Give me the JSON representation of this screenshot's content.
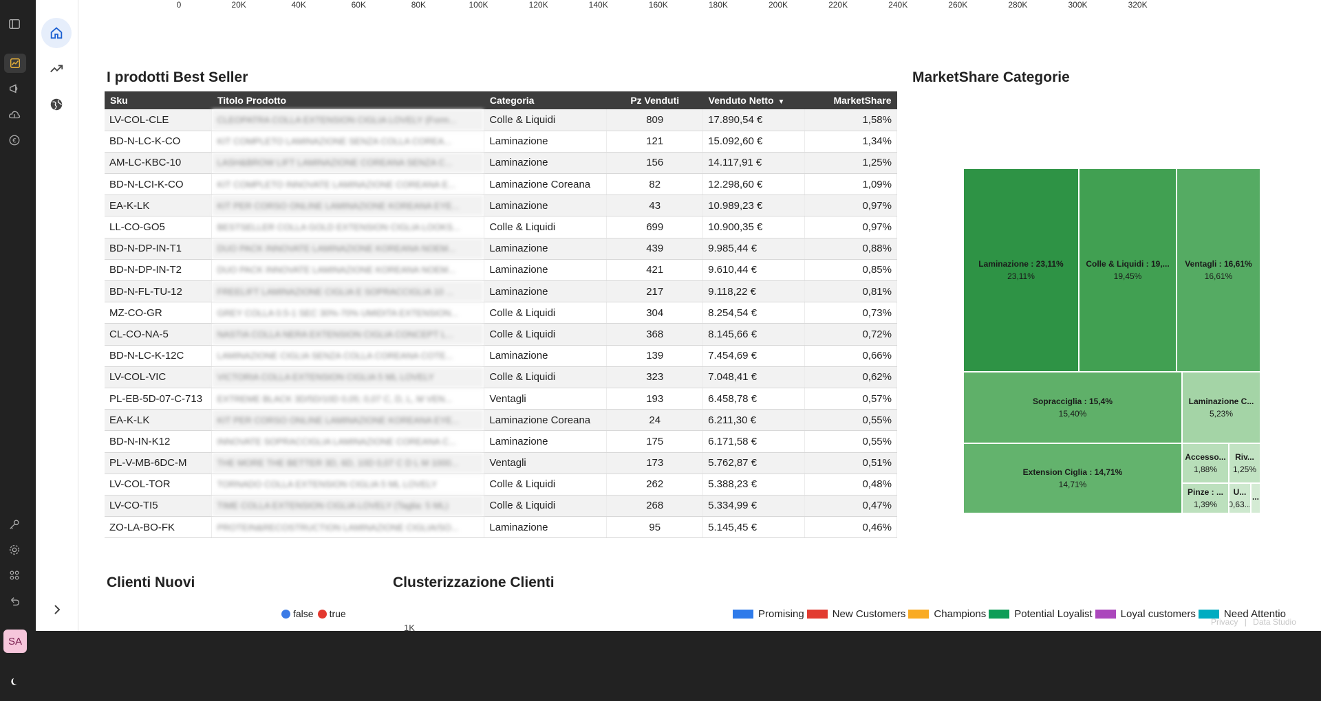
{
  "rail": {
    "avatar_initials": "SA",
    "icons": [
      "sidebar-toggle-icon",
      "analytics-icon",
      "megaphone-icon",
      "cloud-upload-icon",
      "euro-icon",
      "key-icon",
      "gear-icon",
      "apps-icon",
      "undo-icon",
      "moon-icon"
    ]
  },
  "nav": {
    "icons": [
      "home-icon",
      "trending-up-icon",
      "globe-icon"
    ],
    "expand_icon": "chevron-right-icon"
  },
  "top_axis": {
    "ticks": [
      "0",
      "20K",
      "40K",
      "60K",
      "80K",
      "100K",
      "120K",
      "140K",
      "160K",
      "180K",
      "200K",
      "220K",
      "240K",
      "260K",
      "280K",
      "300K",
      "320K"
    ]
  },
  "best_seller": {
    "title": "I prodotti Best Seller",
    "columns": [
      "Sku",
      "Titolo Prodotto",
      "Categoria",
      "Pz Venduti",
      "Venduto Netto",
      "MarketShare"
    ],
    "sort_column": "Venduto Netto",
    "rows": [
      {
        "sku": "LV-COL-CLE",
        "title": "CLEOPATRA COLLA EXTENSION CIGLIA LOVELY (Form...",
        "cat": "Colle & Liquidi",
        "pz": "809",
        "net": "17.890,54 €",
        "share": "1,58%"
      },
      {
        "sku": "BD-N-LC-K-CO",
        "title": "KIT COMPLETO LAMINAZIONE SENZA COLLA COREA...",
        "cat": "Laminazione",
        "pz": "121",
        "net": "15.092,60 €",
        "share": "1,34%"
      },
      {
        "sku": "AM-LC-KBC-10",
        "title": "LASH&BROW LIFT LAMINAZIONE COREANA SENZA C...",
        "cat": "Laminazione",
        "pz": "156",
        "net": "14.117,91 €",
        "share": "1,25%"
      },
      {
        "sku": "BD-N-LCI-K-CO",
        "title": "KIT COMPLETO INNOVATE LAMINAZIONE COREANA E...",
        "cat": "Laminazione Coreana",
        "pz": "82",
        "net": "12.298,60 €",
        "share": "1,09%"
      },
      {
        "sku": "EA-K-LK",
        "title": "KIT PER CORSO ONLINE LAMINAZIONE KOREANA EYE...",
        "cat": "Laminazione",
        "pz": "43",
        "net": "10.989,23 €",
        "share": "0,97%"
      },
      {
        "sku": "LL-CO-GO5",
        "title": "BESTSELLER COLLA GOLD EXTENSION CIGLIA LOOKS...",
        "cat": "Colle & Liquidi",
        "pz": "699",
        "net": "10.900,35 €",
        "share": "0,97%"
      },
      {
        "sku": "BD-N-DP-IN-T1",
        "title": "DUO PACK INNOVATE LAMINAZIONE KOREANA NOEM...",
        "cat": "Laminazione",
        "pz": "439",
        "net": "9.985,44 €",
        "share": "0,88%"
      },
      {
        "sku": "BD-N-DP-IN-T2",
        "title": "DUO PACK INNOVATE LAMINAZIONE KOREANA NOEM...",
        "cat": "Laminazione",
        "pz": "421",
        "net": "9.610,44 €",
        "share": "0,85%"
      },
      {
        "sku": "BD-N-FL-TU-12",
        "title": "FREELIFT LAMINAZIONE CIGLIA E SOPRACCIGLIA 10 ...",
        "cat": "Laminazione",
        "pz": "217",
        "net": "9.118,22 €",
        "share": "0,81%"
      },
      {
        "sku": "MZ-CO-GR",
        "title": "GREY COLLA 0.5-1 SEC 30%-70% UMIDITA EXTENSION...",
        "cat": "Colle & Liquidi",
        "pz": "304",
        "net": "8.254,54 €",
        "share": "0,73%"
      },
      {
        "sku": "CL-CO-NA-5",
        "title": "NASTIA COLLA NERA EXTENSION CIGLIA CONCEPT L...",
        "cat": "Colle & Liquidi",
        "pz": "368",
        "net": "8.145,66 €",
        "share": "0,72%"
      },
      {
        "sku": "BD-N-LC-K-12C",
        "title": "LAMINAZIONE CIGLIA SENZA COLLA COREANA COTE...",
        "cat": "Laminazione",
        "pz": "139",
        "net": "7.454,69 €",
        "share": "0,66%"
      },
      {
        "sku": "LV-COL-VIC",
        "title": "VICTORIA COLLA EXTENSION CIGLIA 5 ML LOVELY",
        "cat": "Colle & Liquidi",
        "pz": "323",
        "net": "7.048,41 €",
        "share": "0,62%"
      },
      {
        "sku": "PL-EB-5D-07-C-713",
        "title": "EXTREME BLACK 3D/5D/10D 0,05; 0,07 C, D, L, M VEN...",
        "cat": "Ventagli",
        "pz": "193",
        "net": "6.458,78 €",
        "share": "0,57%"
      },
      {
        "sku": "EA-K-LK",
        "title": "KIT PER CORSO ONLINE LAMINAZIONE KOREANA EYE...",
        "cat": "Laminazione Coreana",
        "pz": "24",
        "net": "6.211,30 €",
        "share": "0,55%"
      },
      {
        "sku": "BD-N-IN-K12",
        "title": "INNOVATE SOPRACCIGLIA LAMINAZIONE COREANA C...",
        "cat": "Laminazione",
        "pz": "175",
        "net": "6.171,58 €",
        "share": "0,55%"
      },
      {
        "sku": "PL-V-MB-6DC-M",
        "title": "THE MORE THE BETTER 3D, 6D, 10D 0,07 C D L M 1000...",
        "cat": "Ventagli",
        "pz": "173",
        "net": "5.762,87 €",
        "share": "0,51%"
      },
      {
        "sku": "LV-COL-TOR",
        "title": "TORNADO COLLA EXTENSION CIGLIA 5 ML LOVELY",
        "cat": "Colle & Liquidi",
        "pz": "262",
        "net": "5.388,23 €",
        "share": "0,48%"
      },
      {
        "sku": "LV-CO-TI5",
        "title": "TIME COLLA EXTENSION CIGLIA LOVELY (Taglia: 5 ML)",
        "cat": "Colle & Liquidi",
        "pz": "268",
        "net": "5.334,99 €",
        "share": "0,47%"
      },
      {
        "sku": "ZO-LA-BO-FK",
        "title": "PROTEIN&RECOSTRUCTION LAMINAZIONE CIGLIA/SO...",
        "cat": "Laminazione",
        "pz": "95",
        "net": "5.145,45 €",
        "share": "0,46%"
      }
    ]
  },
  "marketshare": {
    "title": "MarketShare Categorie",
    "tiles": [
      {
        "label": "Laminazione : 23,11%",
        "value": "23,11%",
        "color": "#2e9345"
      },
      {
        "label": "Colle & Liquidi : 19,...",
        "value": "19,45%",
        "color": "#41a052"
      },
      {
        "label": "Ventagli : 16,61%",
        "value": "16,61%",
        "color": "#55ab63"
      },
      {
        "label": "Sopracciglia : 15,4%",
        "value": "15,40%",
        "color": "#5fb069"
      },
      {
        "label": "Extension Ciglia : 14,71%",
        "value": "14,71%",
        "color": "#63b36d"
      },
      {
        "label": "Laminazione C...",
        "value": "5,23%",
        "color": "#a4d4a6"
      },
      {
        "label": "Accesso...",
        "value": "1,88%",
        "color": "#b8deb9"
      },
      {
        "label": "Riv...",
        "value": "1,25%",
        "color": "#c2e3c3"
      },
      {
        "label": "Pinze : ...",
        "value": "1,39%",
        "color": "#bce0bd"
      },
      {
        "label": "U...",
        "value": "0,63...",
        "color": "#cde8ce"
      },
      {
        "label": "...",
        "value": "",
        "color": "#d4ebd4"
      }
    ]
  },
  "clienti_nuovi": {
    "title": "Clienti Nuovi",
    "legend": [
      {
        "label": "false",
        "color": "#3b7be6"
      },
      {
        "label": "true",
        "color": "#e3382f"
      }
    ],
    "axis_label": "1K"
  },
  "cluster": {
    "title": "Clusterizzazione Clienti",
    "legend": [
      {
        "label": "Promising",
        "color": "#2f7bea"
      },
      {
        "label": "New Customers",
        "color": "#e23b30"
      },
      {
        "label": "Champions",
        "color": "#f9ab23"
      },
      {
        "label": "Potential Loyalist",
        "color": "#0f9d58"
      },
      {
        "label": "Loyal customers",
        "color": "#ab47bc"
      },
      {
        "label": "Need Attentio",
        "color": "#00acc1"
      }
    ]
  },
  "footer": {
    "privacy": "Privacy",
    "separator": "|",
    "brand": "Data Studio"
  }
}
